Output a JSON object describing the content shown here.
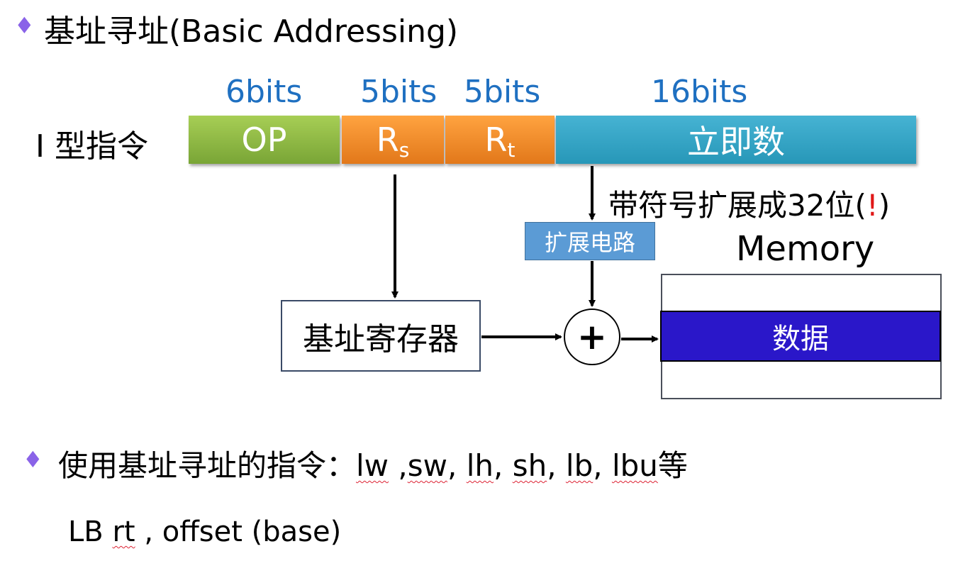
{
  "title": "基址寻址(Basic Addressing)",
  "instruction": {
    "type_label": "I 型指令",
    "fields": [
      {
        "bits": "6bits",
        "name": "OP"
      },
      {
        "bits": "5bits",
        "name": "R",
        "subscript": "s"
      },
      {
        "bits": "5bits",
        "name": "R",
        "subscript": "t"
      },
      {
        "bits": "16bits",
        "name": "立即数"
      }
    ]
  },
  "sign_extend": {
    "text": "带符号扩展成32位(",
    "emphasis": "!",
    "close": ")"
  },
  "extension_circuit": "扩展电路",
  "base_register": "基址寄存器",
  "adder_symbol": "+",
  "memory": {
    "label": "Memory",
    "data": "数据"
  },
  "usage": {
    "prefix": "使用基址寻址的指令：",
    "instructions": [
      "lw",
      "sw",
      "lh",
      "sh",
      "lb",
      "lbu"
    ],
    "suffix": "等"
  },
  "syntax": {
    "op": "LB",
    "rt": "rt",
    "rest": ", offset (base)"
  },
  "colors": {
    "bullet": "#8a63e8",
    "bits_label": "#1f70c1",
    "op_field": "#8cbb44",
    "register_field": "#f08a28",
    "immediate_field": "#35a6c6",
    "ext_circuit": "#5b9bd5",
    "memory_data": "#2a17c9",
    "emphasis": "#e01818"
  },
  "icons": {
    "bullet": "diamond-bullet-icon"
  }
}
